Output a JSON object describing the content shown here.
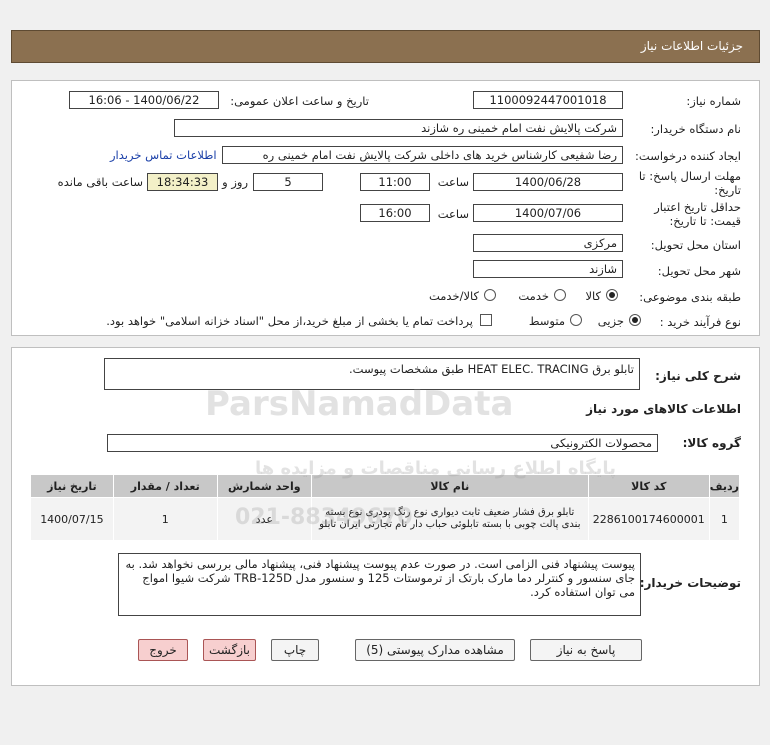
{
  "header": {
    "title": "جزئیات اطلاعات نیاز"
  },
  "form": {
    "need_number_label": "شماره نیاز:",
    "need_number": "1100092447001018",
    "announce_label": "تاریخ و ساعت اعلان عمومی:",
    "announce_value": "1400/06/22 - 16:06",
    "buyer_org_label": "نام دستگاه خریدار:",
    "buyer_org": "شرکت پالایش نفت امام خمینی  ره  شازند",
    "creator_label": "ایجاد کننده درخواست:",
    "creator": "رضا  شفیعی  کارشناس خرید های داخلی  شرکت پالایش نفت امام خمینی  ره",
    "contact_link": "اطلاعات تماس خریدار",
    "deadline_label_1": "مهلت ارسال پاسخ: تا",
    "deadline_label_2": "تاریخ:",
    "deadline_date": "1400/06/28",
    "time_label": "ساعت",
    "deadline_time": "11:00",
    "days_value": "5",
    "days_label": "روز و",
    "remaining_time": "18:34:33",
    "remaining_label": "ساعت باقی مانده",
    "validity_label_1": "حداقل تاریخ اعتبار",
    "validity_label_2": "قیمت: تا تاریخ:",
    "validity_date": "1400/07/06",
    "validity_time_label": "ساعت",
    "validity_time": "16:00",
    "province_label": "استان محل تحویل:",
    "province": "مرکزی",
    "city_label": "شهر محل تحویل:",
    "city": "شازند",
    "category_label": "طبقه بندی موضوعی:",
    "category_options": [
      "کالا",
      "خدمت",
      "کالا/خدمت"
    ],
    "process_label": "نوع فرآیند خرید :",
    "process_options": [
      "جزیی",
      "متوسط"
    ],
    "payment_note": "پرداخت تمام یا بخشی از مبلغ خرید،از محل \"اسناد خزانه اسلامی\" خواهد بود."
  },
  "summary": {
    "label": "شرح کلی نیاز:",
    "value": "تابلو برق HEAT ELEC. TRACING طبق مشخصات پیوست."
  },
  "goods": {
    "section_title": "اطلاعات کالاهای مورد نیاز",
    "group_label": "گروه کالا:",
    "group_value": "محصولات الکترونیکی",
    "columns": [
      "ردیف",
      "کد کالا",
      "نام کالا",
      "واحد شمارش",
      "تعداد / مقدار",
      "تاریخ نیاز"
    ],
    "rows": [
      {
        "row": "1",
        "code": "2286100174600001",
        "name": "تابلو برق فشار ضعیف ثابت دیواری نوع رنگ پودری نوع بسته بندی پالت چوبی با بسته تابلوئی حباب دار نام تجارتی ایران تابلو",
        "unit": "عدد",
        "qty": "1",
        "date": "1400/07/15"
      }
    ]
  },
  "buyer_notes": {
    "label": "توضیحات خریدار:",
    "text": "پیوست پیشنهاد فنی الزامی است. در صورت عدم پیوست پیشنهاد فنی، پیشنهاد مالی بررسی نخواهد شد. به جای سنسور و کنترلر دما مارک بارتک از ترموستات 125 و سنسور مدل TRB-125D شرکت شیوا امواج می توان استفاده کرد."
  },
  "buttons": {
    "reply": "پاسخ به نیاز",
    "attachments": "مشاهده مدارک پیوستی (5)",
    "print": "چاپ",
    "back": "بازگشت",
    "exit": "خروج"
  },
  "watermark": {
    "brand": "ParsNamadData",
    "tagline": "پایگاه اطلاع رسانی مناقصات و مزایده ها",
    "phone": "021-88349670"
  }
}
